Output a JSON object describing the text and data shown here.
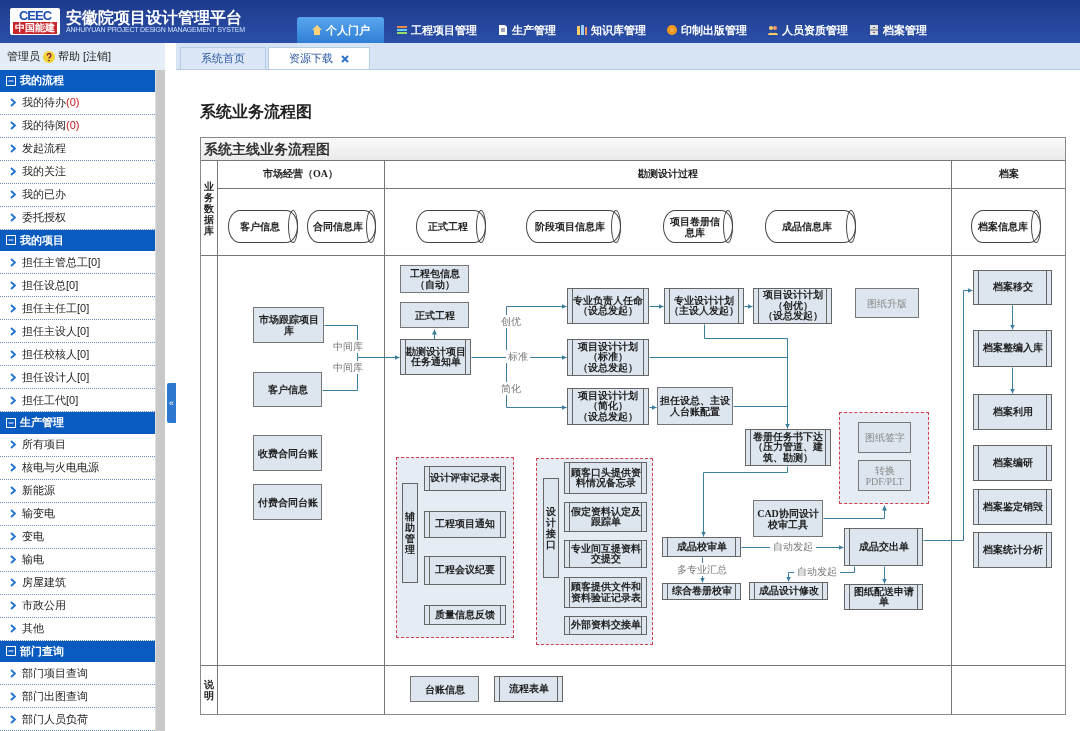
{
  "header": {
    "logo": {
      "letters": "CEEC",
      "name": "中国能建"
    },
    "title": "安徽院项目设计管理平台",
    "subtitle": "ANHUIYUAN PROJECT DESIGN MANAGEMENT SYSTEM"
  },
  "nav": [
    {
      "label": "个人门户",
      "selected": true
    },
    {
      "label": "工程项目管理",
      "selected": false
    },
    {
      "label": "生产管理",
      "selected": false
    },
    {
      "label": "知识库管理",
      "selected": false
    },
    {
      "label": "印制出版管理",
      "selected": false
    },
    {
      "label": "人员资质管理",
      "selected": false
    },
    {
      "label": "档案管理",
      "selected": false
    }
  ],
  "user_bar": {
    "user": "管理员",
    "help": "帮助",
    "logout": "[注销]"
  },
  "tabs": [
    {
      "label": "系统首页",
      "selected": false,
      "closable": false
    },
    {
      "label": "资源下载",
      "selected": true,
      "closable": true
    }
  ],
  "sidebar": {
    "groups": [
      {
        "title": "我的流程",
        "expanded": true,
        "items": [
          {
            "label": "我的待办",
            "count": "(0)"
          },
          {
            "label": "我的待阅",
            "count": "(0)"
          },
          {
            "label": "发起流程"
          },
          {
            "label": "我的关注"
          },
          {
            "label": "我的已办"
          },
          {
            "label": "委托授权"
          }
        ]
      },
      {
        "title": "我的项目",
        "expanded": true,
        "items": [
          {
            "label": "担任主管总工[0]"
          },
          {
            "label": "担任设总[0]"
          },
          {
            "label": "担任主任工[0]"
          },
          {
            "label": "担任主设人[0]"
          },
          {
            "label": "担任校核人[0]"
          },
          {
            "label": "担任设计人[0]"
          },
          {
            "label": "担任工代[0]"
          }
        ]
      },
      {
        "title": "生产管理",
        "expanded": true,
        "items": [
          {
            "label": "所有项目"
          },
          {
            "label": "核电与火电电源"
          },
          {
            "label": "新能源"
          },
          {
            "label": "输变电"
          },
          {
            "label": "变电"
          },
          {
            "label": "输电"
          },
          {
            "label": "房屋建筑"
          },
          {
            "label": "市政公用"
          },
          {
            "label": "其他"
          }
        ]
      },
      {
        "title": "部门查询",
        "expanded": true,
        "items": [
          {
            "label": "部门项目查询"
          },
          {
            "label": "部门出图查询"
          },
          {
            "label": "部门人员负荷"
          }
        ]
      }
    ],
    "collapse_toggle": "«"
  },
  "content": {
    "heading": "系统业务流程图",
    "diagram": {
      "title": "系统主线业务流程图",
      "lanes": [
        "市场经营（OA）",
        "勘测设计过程",
        "档案"
      ],
      "row_labels": [
        "业务数据库",
        "说明"
      ],
      "nodes": [
        {
          "kind": "db",
          "text": "客户信息"
        },
        {
          "kind": "db",
          "text": "合同信息库"
        },
        {
          "kind": "db",
          "text": "正式工程"
        },
        {
          "kind": "db",
          "text": "阶段项目信息库"
        },
        {
          "kind": "db",
          "text": "项目卷册信息库"
        },
        {
          "kind": "db",
          "text": "成品信息库"
        },
        {
          "kind": "db",
          "text": "档案信息库"
        },
        {
          "kind": "process",
          "text": "市场跟踪项目库"
        },
        {
          "kind": "process",
          "text": "客户信息"
        },
        {
          "kind": "process",
          "text": "收费合同台账"
        },
        {
          "kind": "process",
          "text": "付费合同台账"
        },
        {
          "kind": "label",
          "text": "中间库"
        },
        {
          "kind": "label",
          "text": "中间库"
        },
        {
          "kind": "process",
          "text": "工程包信息（自动）"
        },
        {
          "kind": "process",
          "text": "正式工程"
        },
        {
          "kind": "sub",
          "text": "勘测设计项目任务通知单"
        },
        {
          "kind": "label",
          "text": "创优"
        },
        {
          "kind": "label",
          "text": "标准"
        },
        {
          "kind": "label",
          "text": "简化"
        },
        {
          "kind": "sub",
          "text": "专业负责人任命（设总发起）"
        },
        {
          "kind": "sub",
          "text": "项目设计计划（标准）（设总发起）"
        },
        {
          "kind": "sub",
          "text": "项目设计计划（简化）（设总发起）"
        },
        {
          "kind": "sub",
          "text": "专业设计计划（主设人发起）"
        },
        {
          "kind": "sub",
          "text": "项目设计计划（创优）（设总发起）"
        },
        {
          "kind": "note",
          "text": "图纸升版"
        },
        {
          "kind": "process",
          "text": "担任设总、主设人台账配置"
        },
        {
          "kind": "sub",
          "text": "卷册任务书下达（压力管道、建筑、勘测）"
        },
        {
          "kind": "group"
        },
        {
          "kind": "note",
          "text": "图纸签字"
        },
        {
          "kind": "note",
          "text": "转换PDF/PLT"
        },
        {
          "kind": "process",
          "text": "CAD协同设计校审工具"
        },
        {
          "kind": "sub",
          "text": "成品校审单"
        },
        {
          "kind": "label",
          "text": "自动发起"
        },
        {
          "kind": "sub",
          "text": "成品交出单"
        },
        {
          "kind": "label",
          "text": "多专业汇总"
        },
        {
          "kind": "label",
          "text": "自动发起"
        },
        {
          "kind": "sub",
          "text": "综合卷册校审"
        },
        {
          "kind": "sub",
          "text": "成品设计修改"
        },
        {
          "kind": "sub",
          "text": "图纸配送申请单"
        },
        {
          "kind": "group"
        },
        {
          "kind": "vlabel",
          "text": "辅助管理"
        },
        {
          "kind": "sub",
          "text": "设计评审记录表"
        },
        {
          "kind": "sub",
          "text": "工程项目通知"
        },
        {
          "kind": "sub",
          "text": "工程会议纪要"
        },
        {
          "kind": "sub",
          "text": "质量信息反馈"
        },
        {
          "kind": "group"
        },
        {
          "kind": "vlabel",
          "text": "设计接口"
        },
        {
          "kind": "sub",
          "text": "顾客口头提供资料情况备忘录"
        },
        {
          "kind": "sub",
          "text": "假定资料认定及跟踪单"
        },
        {
          "kind": "sub",
          "text": "专业间互提资料交提交"
        },
        {
          "kind": "sub",
          "text": "顾客提供文件和资料验证记录表"
        },
        {
          "kind": "sub",
          "text": "外部资料交接单"
        },
        {
          "kind": "sub",
          "text": "档案移交"
        },
        {
          "kind": "sub",
          "text": "档案整编入库"
        },
        {
          "kind": "sub",
          "text": "档案利用"
        },
        {
          "kind": "sub",
          "text": "档案编研"
        },
        {
          "kind": "sub",
          "text": "档案鉴定销毁"
        },
        {
          "kind": "sub",
          "text": "档案统计分析"
        },
        {
          "kind": "process",
          "text": "台账信息"
        },
        {
          "kind": "sub",
          "text": "流程表单"
        }
      ]
    }
  }
}
